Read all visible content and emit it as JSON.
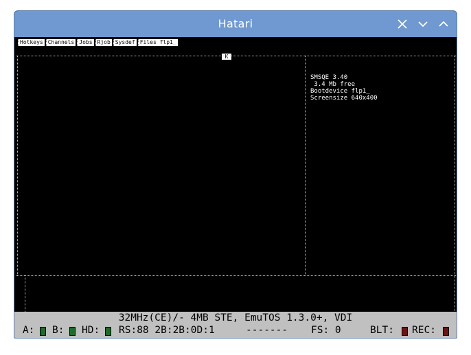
{
  "window": {
    "title": "Hatari",
    "controls": [
      "close-icon",
      "minimize-icon",
      "maximize-icon"
    ]
  },
  "tabs": [
    {
      "label": "Hotkeys"
    },
    {
      "label": "Channels"
    },
    {
      "label": "Jobs"
    },
    {
      "label": "Rjob"
    },
    {
      "label": "Sysdef"
    },
    {
      "label": "Files flp1_"
    }
  ],
  "cursor_glyph": "K",
  "info": {
    "line1": "SMSQE 3.40",
    "line2": " 3.4 Mb free",
    "line3": "Bootdevice flp1_",
    "line4": "Screensize 640x400"
  },
  "status": {
    "line1": "32MHz(CE)/- 4MB STE, EmuTOS 1.3.0+, VDI",
    "drive_a_label": "A:",
    "drive_b_label": "B:",
    "hd_label": "HD:",
    "rs_text": "RS:88 2B:2B:0D:1",
    "dashes": "-------",
    "fs_text": "FS: 0",
    "blt_label": "BLT:",
    "rec_label": "REC:",
    "led_green": "#1f6b2a",
    "led_red": "#6b1414"
  },
  "colors": {
    "titlebar": "#6f99d0",
    "screen_bg": "#000000",
    "statusbar": "#c0c0c0"
  }
}
